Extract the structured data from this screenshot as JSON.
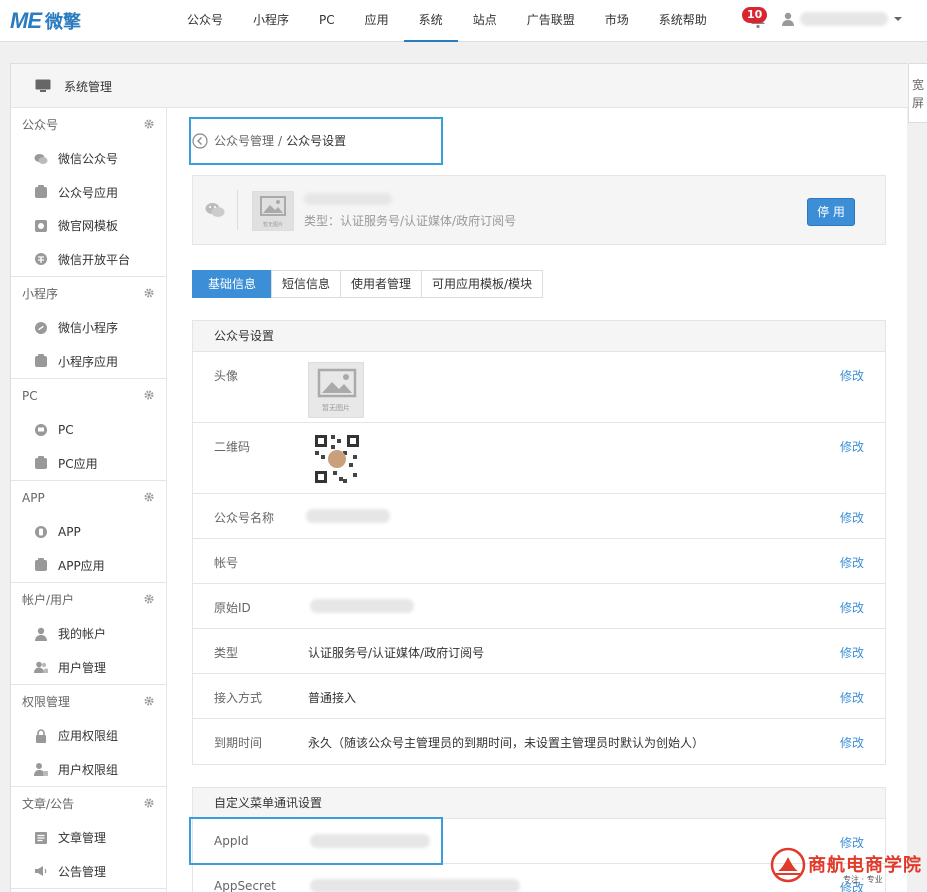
{
  "brand": {
    "logo_mark": "ME",
    "logo_text": "微擎",
    "color": "#2b7bc0"
  },
  "topnav": [
    {
      "label": "公众号",
      "active": false
    },
    {
      "label": "小程序",
      "active": false
    },
    {
      "label": "PC",
      "active": false
    },
    {
      "label": "应用",
      "active": false
    },
    {
      "label": "系统",
      "active": true
    },
    {
      "label": "站点",
      "active": false
    },
    {
      "label": "广告联盟",
      "active": false
    },
    {
      "label": "市场",
      "active": false
    },
    {
      "label": "系统帮助",
      "active": false
    }
  ],
  "notifications": {
    "count": "10"
  },
  "frame": {
    "title": "系统管理",
    "widescreen": "宽屏"
  },
  "sidebar": [
    {
      "title": "公众号",
      "items": [
        {
          "label": "微信公众号",
          "icon": "wechat-icon"
        },
        {
          "label": "公众号应用",
          "icon": "app-icon"
        },
        {
          "label": "微官网模板",
          "icon": "template-icon"
        },
        {
          "label": "微信开放平台",
          "icon": "platform-icon"
        }
      ]
    },
    {
      "title": "小程序",
      "items": [
        {
          "label": "微信小程序",
          "icon": "miniprogram-icon"
        },
        {
          "label": "小程序应用",
          "icon": "app-icon"
        }
      ]
    },
    {
      "title": "PC",
      "items": [
        {
          "label": "PC",
          "icon": "pc-icon"
        },
        {
          "label": "PC应用",
          "icon": "app-icon"
        }
      ]
    },
    {
      "title": "APP",
      "items": [
        {
          "label": "APP",
          "icon": "phone-icon"
        },
        {
          "label": "APP应用",
          "icon": "app-icon"
        }
      ]
    },
    {
      "title": "帐户/用户",
      "items": [
        {
          "label": "我的帐户",
          "icon": "user-icon"
        },
        {
          "label": "用户管理",
          "icon": "users-icon"
        }
      ]
    },
    {
      "title": "权限管理",
      "items": [
        {
          "label": "应用权限组",
          "icon": "lock-icon"
        },
        {
          "label": "用户权限组",
          "icon": "user-lock-icon"
        }
      ]
    },
    {
      "title": "文章/公告",
      "items": [
        {
          "label": "文章管理",
          "icon": "article-icon"
        },
        {
          "label": "公告管理",
          "icon": "megaphone-icon"
        }
      ]
    }
  ],
  "breadcrumb": {
    "parent": "公众号管理",
    "separator": "/",
    "current": "公众号设置"
  },
  "account": {
    "image_caption": "暂无图片",
    "type_text": "类型：认证服务号/认证媒体/政府订阅号",
    "stop_button": "停 用"
  },
  "tabs": [
    {
      "label": "基础信息",
      "active": true
    },
    {
      "label": "短信信息",
      "active": false
    },
    {
      "label": "使用者管理",
      "active": false
    },
    {
      "label": "可用应用模板/模块",
      "active": false
    }
  ],
  "settings_panel": {
    "title": "公众号设置",
    "edit_label": "修改",
    "avatar_caption": "暂无图片",
    "rows": [
      {
        "label": "头像",
        "value": ""
      },
      {
        "label": "二维码",
        "value": ""
      },
      {
        "label": "公众号名称",
        "value": ""
      },
      {
        "label": "帐号",
        "value": ""
      },
      {
        "label": "原始ID",
        "value": ""
      },
      {
        "label": "类型",
        "value": "认证服务号/认证媒体/政府订阅号"
      },
      {
        "label": "接入方式",
        "value": "普通接入"
      },
      {
        "label": "到期时间",
        "value": "永久（随该公众号主管理员的到期时间，未设置主管理员时默认为创始人）"
      }
    ]
  },
  "menu_panel": {
    "title": "自定义菜单通讯设置",
    "rows": [
      {
        "label": "AppId",
        "value": ""
      },
      {
        "label": "AppSecret",
        "value": ""
      }
    ]
  },
  "watermark": {
    "title": "商航电商学院",
    "subtitle": "专注 · 专业"
  },
  "colors": {
    "accent": "#3c8fd6",
    "highlight_box": "#3a9fd8",
    "badge": "#d9252f"
  }
}
